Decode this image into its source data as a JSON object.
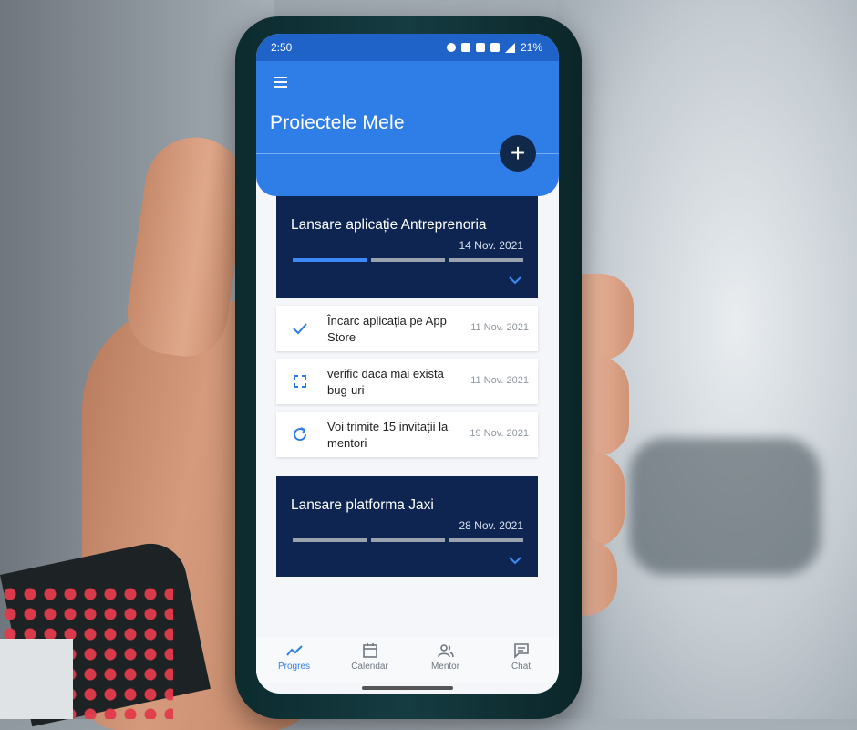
{
  "status_bar": {
    "time": "2:50",
    "battery": "21%"
  },
  "header": {
    "title": "Proiectele Mele"
  },
  "projects": [
    {
      "title": "Lansare aplicație Antreprenoria",
      "date": "14 Nov. 2021",
      "progress_segments_done": 1,
      "progress_segments_total": 3
    },
    {
      "title": "Lansare platforma Jaxi",
      "date": "28 Nov. 2021",
      "progress_segments_done": 0,
      "progress_segments_total": 3
    }
  ],
  "tasks": [
    {
      "text": "Încarc aplicația pe App Store",
      "date": "11 Nov. 2021",
      "icon": "check-icon"
    },
    {
      "text": "verific daca mai exista bug-uri",
      "date": "11 Nov. 2021",
      "icon": "focus-frame-icon"
    },
    {
      "text": "Voi trimite 15 invitații la mentori",
      "date": "19 Nov. 2021",
      "icon": "refresh-icon"
    }
  ],
  "nav": [
    {
      "label": "Progres",
      "icon": "trend-icon",
      "active": true
    },
    {
      "label": "Calendar",
      "icon": "calendar-icon",
      "active": false
    },
    {
      "label": "Mentor",
      "icon": "people-icon",
      "active": false
    },
    {
      "label": "Chat",
      "icon": "chat-icon",
      "active": false
    }
  ],
  "colors": {
    "primary": "#2f7de6",
    "card_dark": "#0d2550",
    "fab": "#10284a",
    "progress_done": "#3d8af7"
  }
}
